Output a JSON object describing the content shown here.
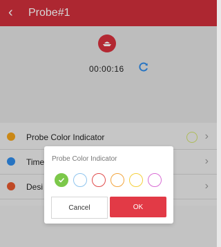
{
  "header": {
    "back_icon": "chevron-left-icon",
    "title": "Probe#1",
    "color": "#cf2f3b"
  },
  "timer": {
    "probe_icon": "probe-icon",
    "value": "00:00:16",
    "refresh_icon": "refresh-icon"
  },
  "settings": {
    "rows": [
      {
        "label": "Probe Color Indicator",
        "icon": "palette-icon",
        "icon_color": "#f1a21b"
      },
      {
        "label": "Time",
        "icon": "clock-icon",
        "icon_color": "#2f8be8"
      },
      {
        "label": "Desi",
        "icon": "doneness-icon",
        "icon_color": "#e4572e"
      }
    ]
  },
  "dialog": {
    "title": "Probe Color Indicator",
    "colors": [
      "#7cc84a",
      "#8ec4ee",
      "#e04a4a",
      "#f2a33b",
      "#f5cf3a",
      "#d86bd4"
    ],
    "selected_index": 0,
    "cancel_label": "Cancel",
    "ok_label": "OK"
  }
}
